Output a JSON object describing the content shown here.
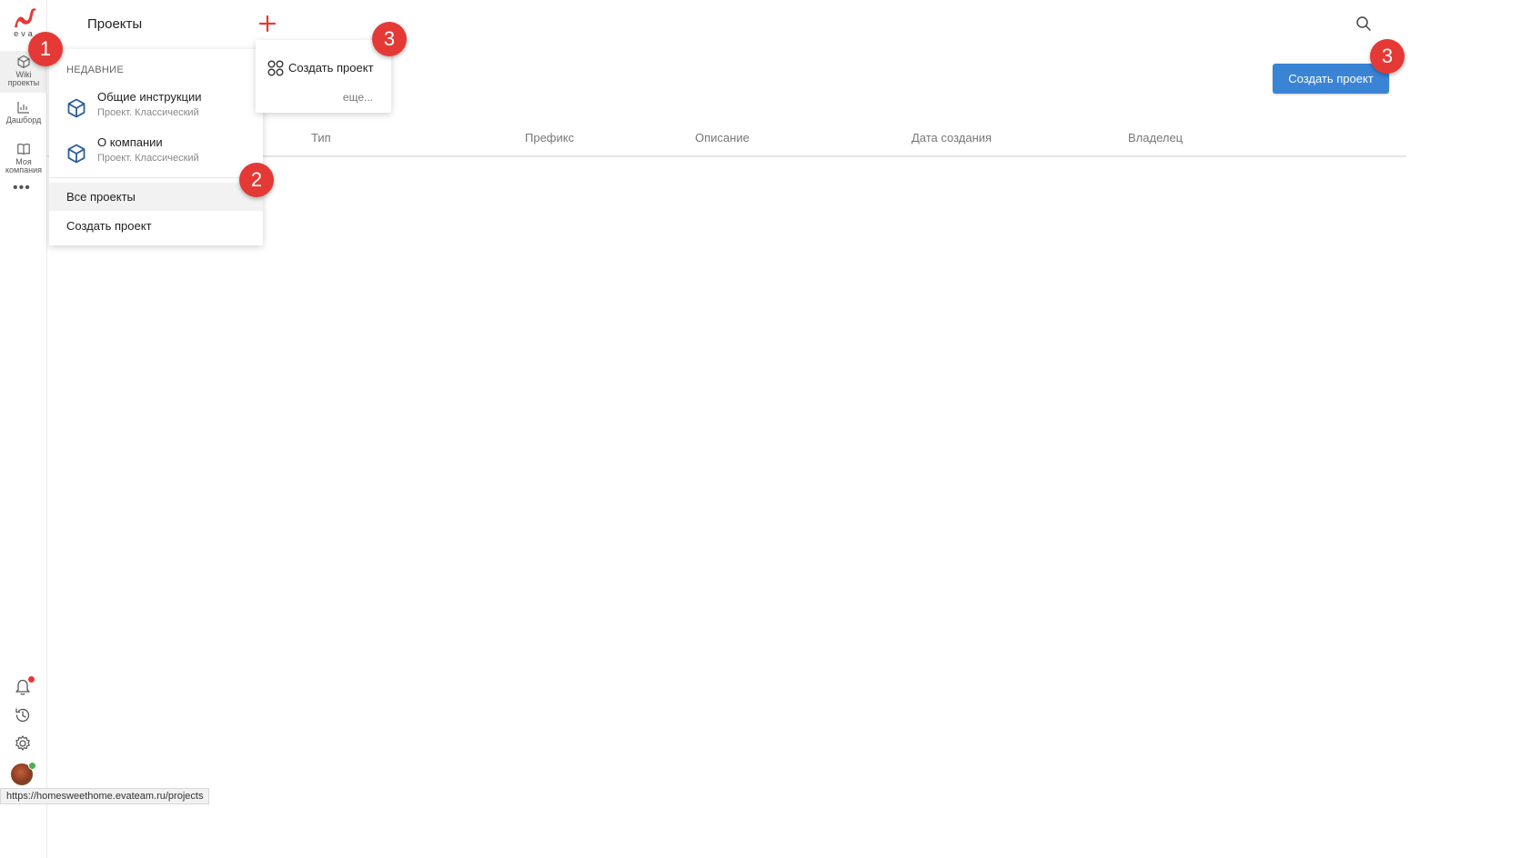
{
  "brand": {
    "logo_text": "eva",
    "accent": "#e53935"
  },
  "rail": {
    "items": [
      {
        "label": "Wiki проекты",
        "icon": "cube-icon",
        "active": true
      },
      {
        "label": "Дашборд",
        "icon": "chart-icon"
      },
      {
        "label": "Моя компания",
        "icon": "book-icon"
      }
    ],
    "more": "•••"
  },
  "header": {
    "title": "Проекты"
  },
  "actions": {
    "create_button": "Создать проект",
    "button_color": "#3a84d6"
  },
  "table": {
    "columns": [
      "Тип",
      "Префикс",
      "Описание",
      "Дата создания",
      "Владелец"
    ]
  },
  "menu": {
    "section_title": "НЕДАВНИЕ",
    "recent": [
      {
        "name": "Общие инструкции",
        "sub": "Проект. Классический"
      },
      {
        "name": "О компании",
        "sub": "Проект. Классический"
      }
    ],
    "all_projects": "Все проекты",
    "create_project": "Создать проект"
  },
  "popup": {
    "create_label": "Создать проект",
    "more_label": "еще..."
  },
  "badges": [
    "1",
    "2",
    "3",
    "3"
  ],
  "statusbar": {
    "url": "https://homesweethome.evateam.ru/projects"
  }
}
